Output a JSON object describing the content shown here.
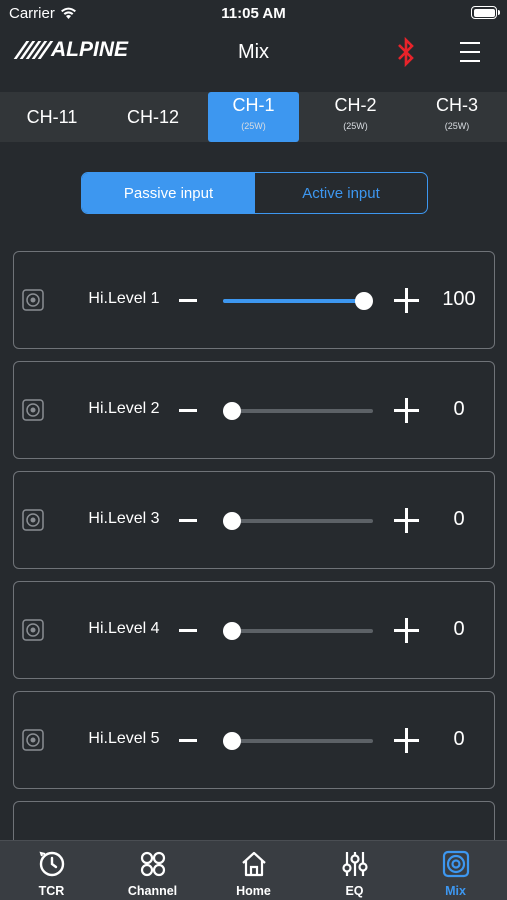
{
  "status": {
    "carrier": "Carrier",
    "time": "11:05 AM"
  },
  "header": {
    "logo_text": "ALPINE",
    "title": "Mix",
    "bluetooth_color": "#e8232a"
  },
  "tabs": [
    {
      "label": "CH-11",
      "sub": "",
      "active": false
    },
    {
      "label": "CH-12",
      "sub": "",
      "active": false
    },
    {
      "label": "CH-1",
      "sub": "(25W)",
      "active": true
    },
    {
      "label": "CH-2",
      "sub": "(25W)",
      "active": false
    },
    {
      "label": "CH-3",
      "sub": "(25W)",
      "active": false
    }
  ],
  "input_mode": {
    "passive_label": "Passive input",
    "active_label": "Active input",
    "selected": "passive"
  },
  "levels": [
    {
      "label": "Hi.Level 1",
      "value": "100",
      "fraction": 1.0
    },
    {
      "label": "Hi.Level 2",
      "value": "0",
      "fraction": 0.0
    },
    {
      "label": "Hi.Level 3",
      "value": "0",
      "fraction": 0.0
    },
    {
      "label": "Hi.Level 4",
      "value": "0",
      "fraction": 0.0
    },
    {
      "label": "Hi.Level 5",
      "value": "0",
      "fraction": 0.0
    }
  ],
  "nav": [
    {
      "label": "TCR",
      "icon": "clock-icon",
      "active": false
    },
    {
      "label": "Channel",
      "icon": "grid-icon",
      "active": false
    },
    {
      "label": "Home",
      "icon": "home-icon",
      "active": false
    },
    {
      "label": "EQ",
      "icon": "equalizer-icon",
      "active": false
    },
    {
      "label": "Mix",
      "icon": "speaker-icon",
      "active": true
    }
  ],
  "colors": {
    "accent": "#3d97f0",
    "background": "#262a2e",
    "nav_background": "#393d42"
  }
}
